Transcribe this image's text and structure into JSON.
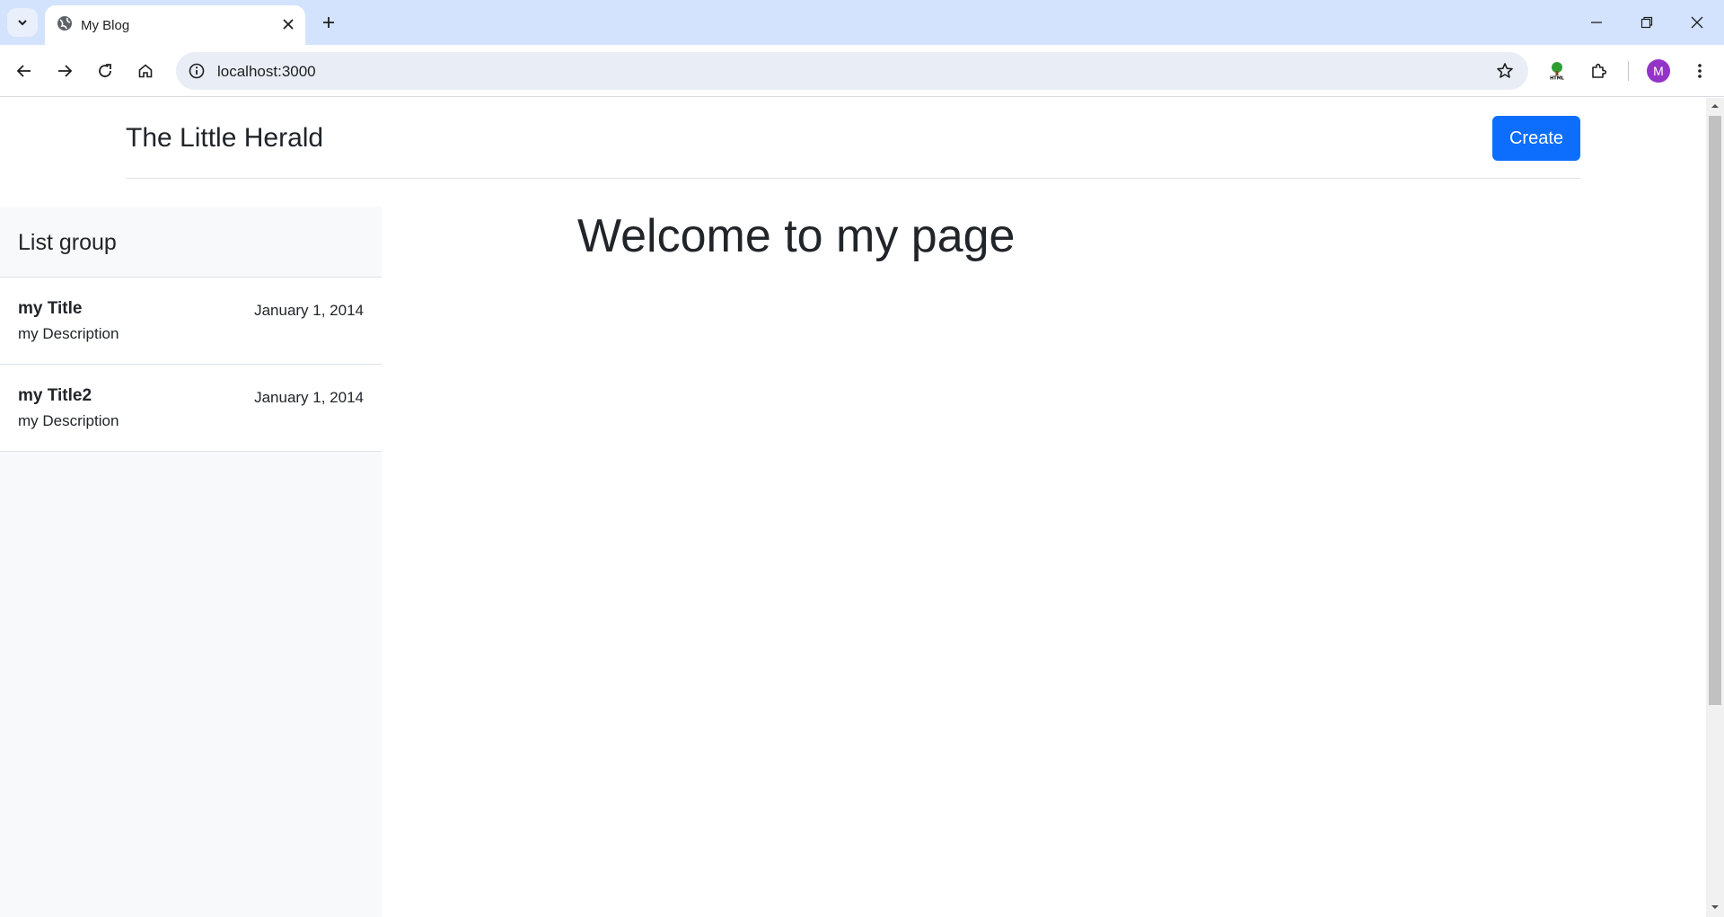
{
  "browser": {
    "tab_title": "My Blog",
    "url": "localhost:3000",
    "avatar_letter": "M"
  },
  "header": {
    "brand": "The Little Herald",
    "create_label": "Create"
  },
  "sidebar": {
    "heading": "List group",
    "items": [
      {
        "title": "my Title",
        "date": "January 1, 2014",
        "description": "my Description"
      },
      {
        "title": "my Title2",
        "date": "January 1, 2014",
        "description": "my Description"
      }
    ]
  },
  "main": {
    "heading": "Welcome to my page"
  },
  "colors": {
    "accent": "#0d6efd",
    "tabstrip": "#d3e3fd",
    "sidebar_bg": "#f8f9fa",
    "avatar": "#9334c9"
  }
}
